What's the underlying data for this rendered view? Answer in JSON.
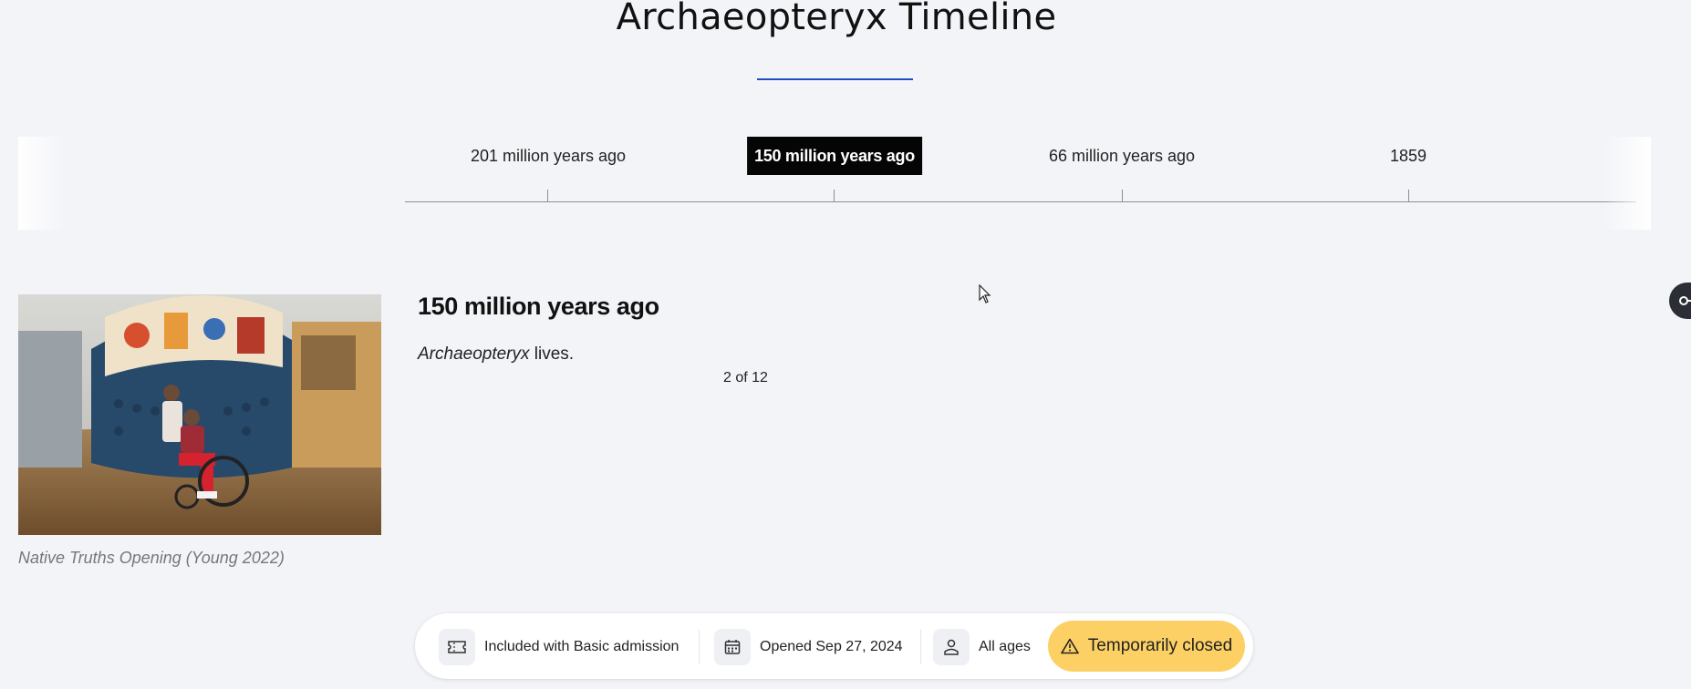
{
  "page": {
    "title": "Archaeopteryx Timeline"
  },
  "timeline": {
    "items": [
      {
        "label": "201 million years ago"
      },
      {
        "label": "150 million years ago",
        "active": true
      },
      {
        "label": "66 million years ago"
      },
      {
        "label": "1859"
      }
    ]
  },
  "event": {
    "title": "150 million years ago",
    "description_italic": "Archaeopteryx",
    "description_rest": " lives.",
    "counter": "2 of 12"
  },
  "image": {
    "caption": "Native Truths Opening (Young 2022)"
  },
  "info_bar": {
    "admission": "Included with Basic admission",
    "opened": "Opened Sep 27, 2024",
    "ages": "All ages",
    "status": "Temporarily closed"
  },
  "colors": {
    "accent": "#1f4fbf",
    "status_bg": "#fcd065",
    "active_tab_bg": "#050505",
    "page_bg": "#f3f4f8"
  }
}
